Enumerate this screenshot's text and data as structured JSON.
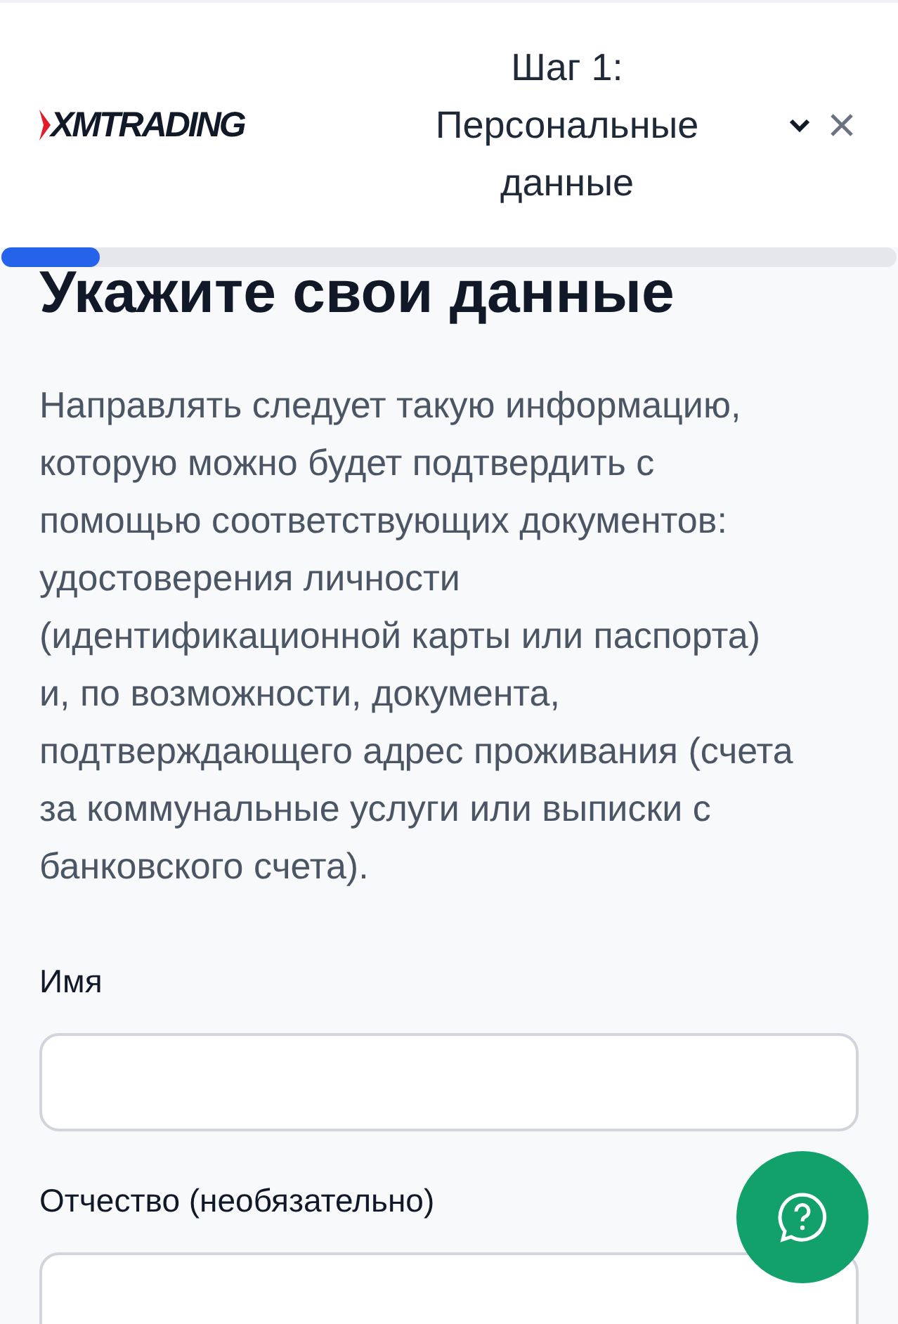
{
  "header": {
    "logo": "XMTRADING",
    "step": "Шаг 1:",
    "step_title": "Персональные данные"
  },
  "progress": {
    "level": 0.11
  },
  "title": "Укажите свои данные",
  "description": "Направлять следует такую информацию, которую можно будет подтвердить с помощью соответствующих документов: удостоверения личности (идентификационной карты или паспорта) и, по возможности, документа, подтверждающего адрес проживания (счета за коммунальные услуги или выписки с банковского счета).",
  "fields": [
    {
      "label": "Имя"
    },
    {
      "label": "Отчество (необязательно)"
    }
  ]
}
